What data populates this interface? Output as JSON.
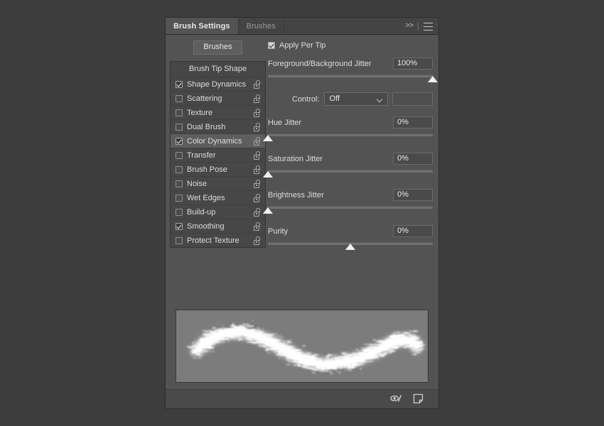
{
  "window": {
    "background_color": "#3d3d3d",
    "panel_bg": "#535353"
  },
  "tabs": [
    {
      "label": "Brush Settings",
      "active": true
    },
    {
      "label": "Brushes",
      "active": false
    }
  ],
  "tabbar": {
    "overflow_label": ">>",
    "overflow_icon": "chevron-double-right-icon",
    "menu_icon": "hamburger-menu-icon"
  },
  "left_panel": {
    "brushes_button": "Brushes",
    "list_header": "Brush Tip Shape",
    "items": [
      {
        "label": "Shape Dynamics",
        "checked": true,
        "selected": false,
        "locked": false
      },
      {
        "label": "Scattering",
        "checked": false,
        "selected": false,
        "locked": false
      },
      {
        "label": "Texture",
        "checked": false,
        "selected": false,
        "locked": false
      },
      {
        "label": "Dual Brush",
        "checked": false,
        "selected": false,
        "locked": false
      },
      {
        "label": "Color Dynamics",
        "checked": true,
        "selected": true,
        "locked": false
      },
      {
        "label": "Transfer",
        "checked": false,
        "selected": false,
        "locked": false
      },
      {
        "label": "Brush Pose",
        "checked": false,
        "selected": false,
        "locked": false
      },
      {
        "label": "Noise",
        "checked": false,
        "selected": false,
        "locked": false
      },
      {
        "label": "Wet Edges",
        "checked": false,
        "selected": false,
        "locked": false
      },
      {
        "label": "Build-up",
        "checked": false,
        "selected": false,
        "locked": false
      },
      {
        "label": "Smoothing",
        "checked": true,
        "selected": false,
        "locked": false
      },
      {
        "label": "Protect Texture",
        "checked": false,
        "selected": false,
        "locked": false
      }
    ]
  },
  "right_panel": {
    "apply_per_tip": {
      "label": "Apply Per Tip",
      "checked": true
    },
    "fg_bg_jitter": {
      "label": "Foreground/Background Jitter",
      "value": "100%",
      "slider_percent": 100
    },
    "control": {
      "label": "Control:",
      "value": "Off",
      "options": [
        "Off"
      ]
    },
    "hue_jitter": {
      "label": "Hue Jitter",
      "value": "0%",
      "slider_percent": 0
    },
    "saturation_jitter": {
      "label": "Saturation Jitter",
      "value": "0%",
      "slider_percent": 0
    },
    "brightness_jitter": {
      "label": "Brightness Jitter",
      "value": "0%",
      "slider_percent": 0
    },
    "purity": {
      "label": "Purity",
      "value": "0%",
      "slider_percent": 50
    }
  },
  "preview": {
    "name": "brush-stroke-preview",
    "stroke_color": "#ffffff",
    "background_color": "#7c7c7c"
  },
  "footer": {
    "toggle_brush_preview_icon": "eye-brush-icon",
    "create_new_brush_icon": "new-brush-page-icon"
  }
}
